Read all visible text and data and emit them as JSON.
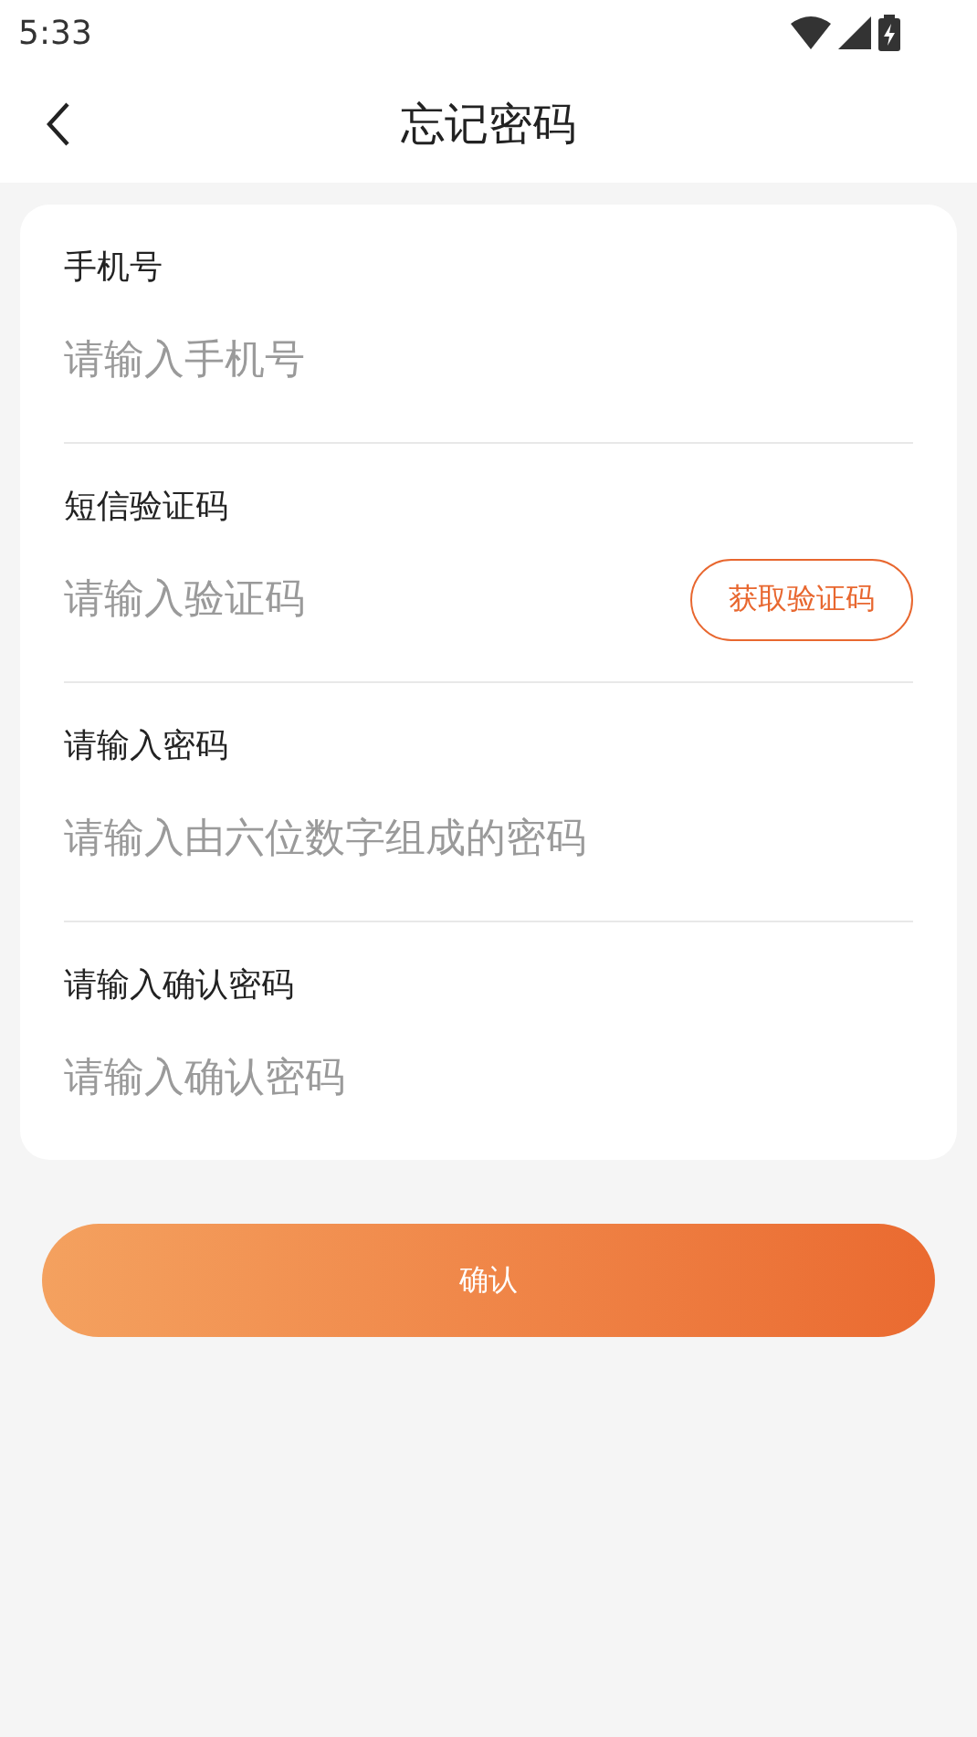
{
  "status_bar": {
    "time": "5:33"
  },
  "header": {
    "title": "忘记密码"
  },
  "fields": [
    {
      "label": "手机号",
      "placeholder": "请输入手机号"
    },
    {
      "label": "短信验证码",
      "placeholder": "请输入验证码",
      "action": "获取验证码"
    },
    {
      "label": "请输入密码",
      "placeholder": "请输入由六位数字组成的密码"
    },
    {
      "label": "请输入确认密码",
      "placeholder": "请输入确认密码"
    }
  ],
  "confirm_button": {
    "label": "确认"
  }
}
